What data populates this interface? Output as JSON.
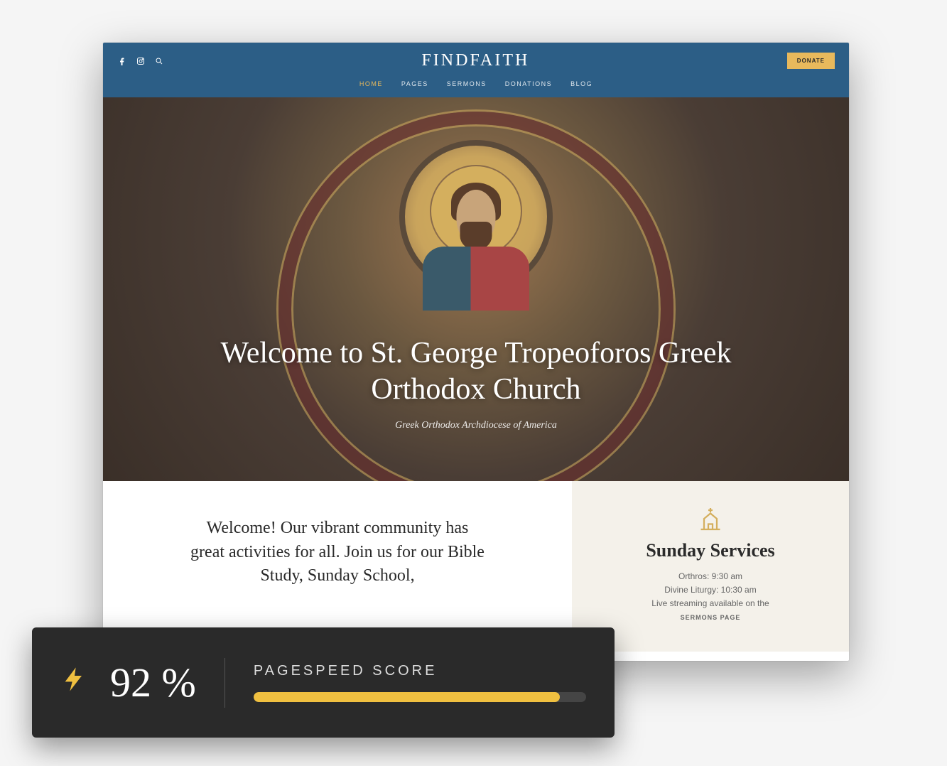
{
  "header": {
    "logo": "FINDFAITH",
    "donate_label": "DONATE",
    "nav": [
      {
        "label": "HOME",
        "active": true
      },
      {
        "label": "PAGES",
        "active": false
      },
      {
        "label": "SERMONS",
        "active": false
      },
      {
        "label": "DONATIONS",
        "active": false
      },
      {
        "label": "BLOG",
        "active": false
      }
    ],
    "social_icons": [
      "facebook-icon",
      "instagram-icon",
      "search-icon"
    ]
  },
  "hero": {
    "title": "Welcome to St. George Tropeoforos Greek Orthodox Church",
    "subtitle": "Greek Orthodox Archdiocese of America"
  },
  "intro": {
    "text": "Welcome! Our vibrant community has great activities for all. Join us for our Bible Study, Sunday School,"
  },
  "services": {
    "title": "Sunday Services",
    "line1": "Orthros: 9:30 am",
    "line2": "Divine Liturgy: 10:30 am",
    "line3": "Live streaming available on the",
    "link": "SERMONS PAGE"
  },
  "pagespeed": {
    "score": "92 %",
    "label": "PAGESPEED SCORE",
    "percent": 92
  },
  "colors": {
    "header_bg": "#2c5e86",
    "accent": "#e8b95c",
    "dark": "#2a2a2a",
    "bolt": "#f0c040"
  }
}
